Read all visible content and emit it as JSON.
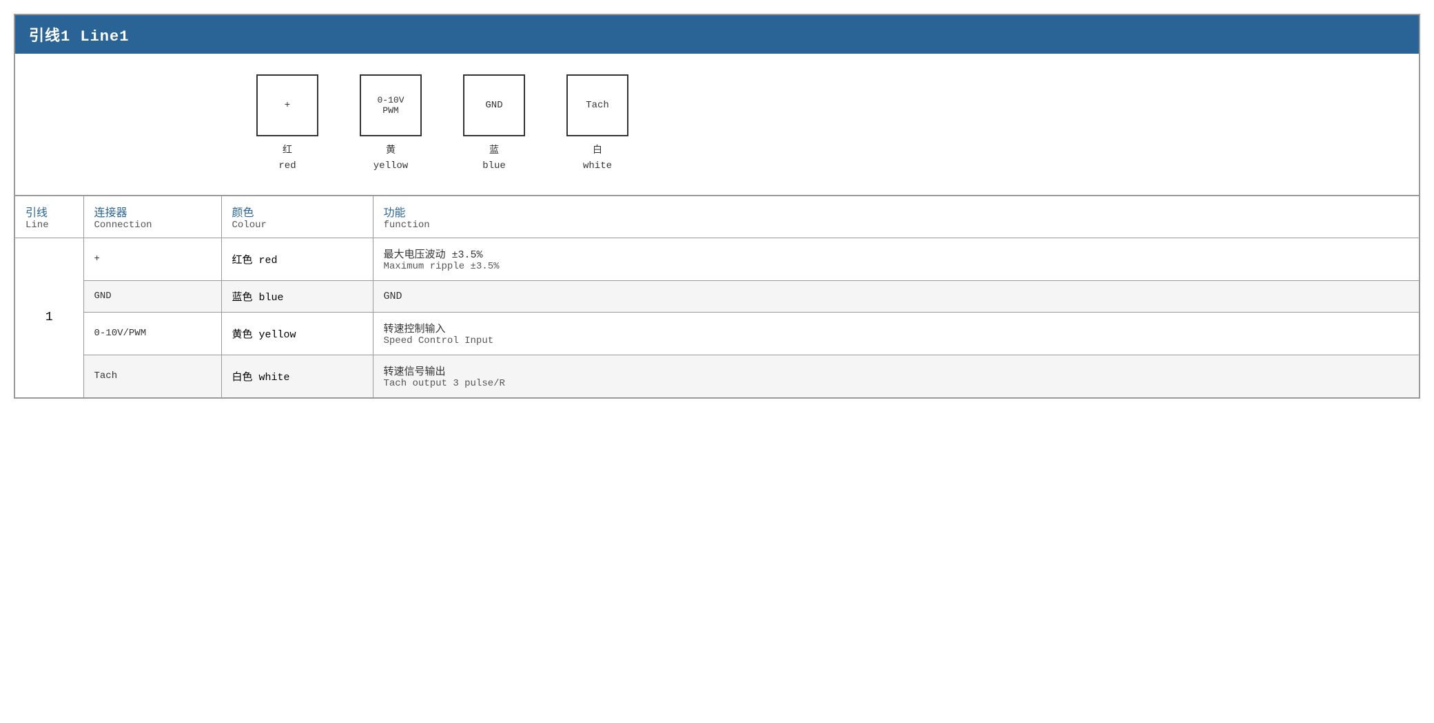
{
  "title": "引线1 Line1",
  "diagram": {
    "connectors": [
      {
        "id": "plus",
        "symbol": "+",
        "label_zh": "红",
        "label_en": "red"
      },
      {
        "id": "pwm",
        "symbol": "0-10V\nPWM",
        "label_zh": "黄",
        "label_en": "yellow"
      },
      {
        "id": "gnd",
        "symbol": "GND",
        "label_zh": "蓝",
        "label_en": "blue"
      },
      {
        "id": "tach",
        "symbol": "Tach",
        "label_zh": "白",
        "label_en": "white"
      }
    ]
  },
  "table": {
    "headers": {
      "line_zh": "引线",
      "line_en": "Line",
      "connection_zh": "连接器",
      "connection_en": "Connection",
      "colour_zh": "颜色",
      "colour_en": "Colour",
      "function_zh": "功能",
      "function_en": "function"
    },
    "rows": [
      {
        "line": "1",
        "connection": "+",
        "colour_zh": "红色 red",
        "function_zh": "最大电压波动 ±3.5%",
        "function_en": "Maximum ripple ±3.5%",
        "bg": "white"
      },
      {
        "line": "",
        "connection": "GND",
        "colour_zh": "蓝色 blue",
        "function_zh": "GND",
        "function_en": "",
        "bg": "light"
      },
      {
        "line": "",
        "connection": "0-10V/PWM",
        "colour_zh": "黄色 yellow",
        "function_zh": "转速控制输入",
        "function_en": "Speed Control Input",
        "bg": "white"
      },
      {
        "line": "",
        "connection": "Tach",
        "colour_zh": "白色 white",
        "function_zh": "转速信号输出",
        "function_en": "Tach output 3 pulse/R",
        "bg": "light"
      }
    ]
  }
}
